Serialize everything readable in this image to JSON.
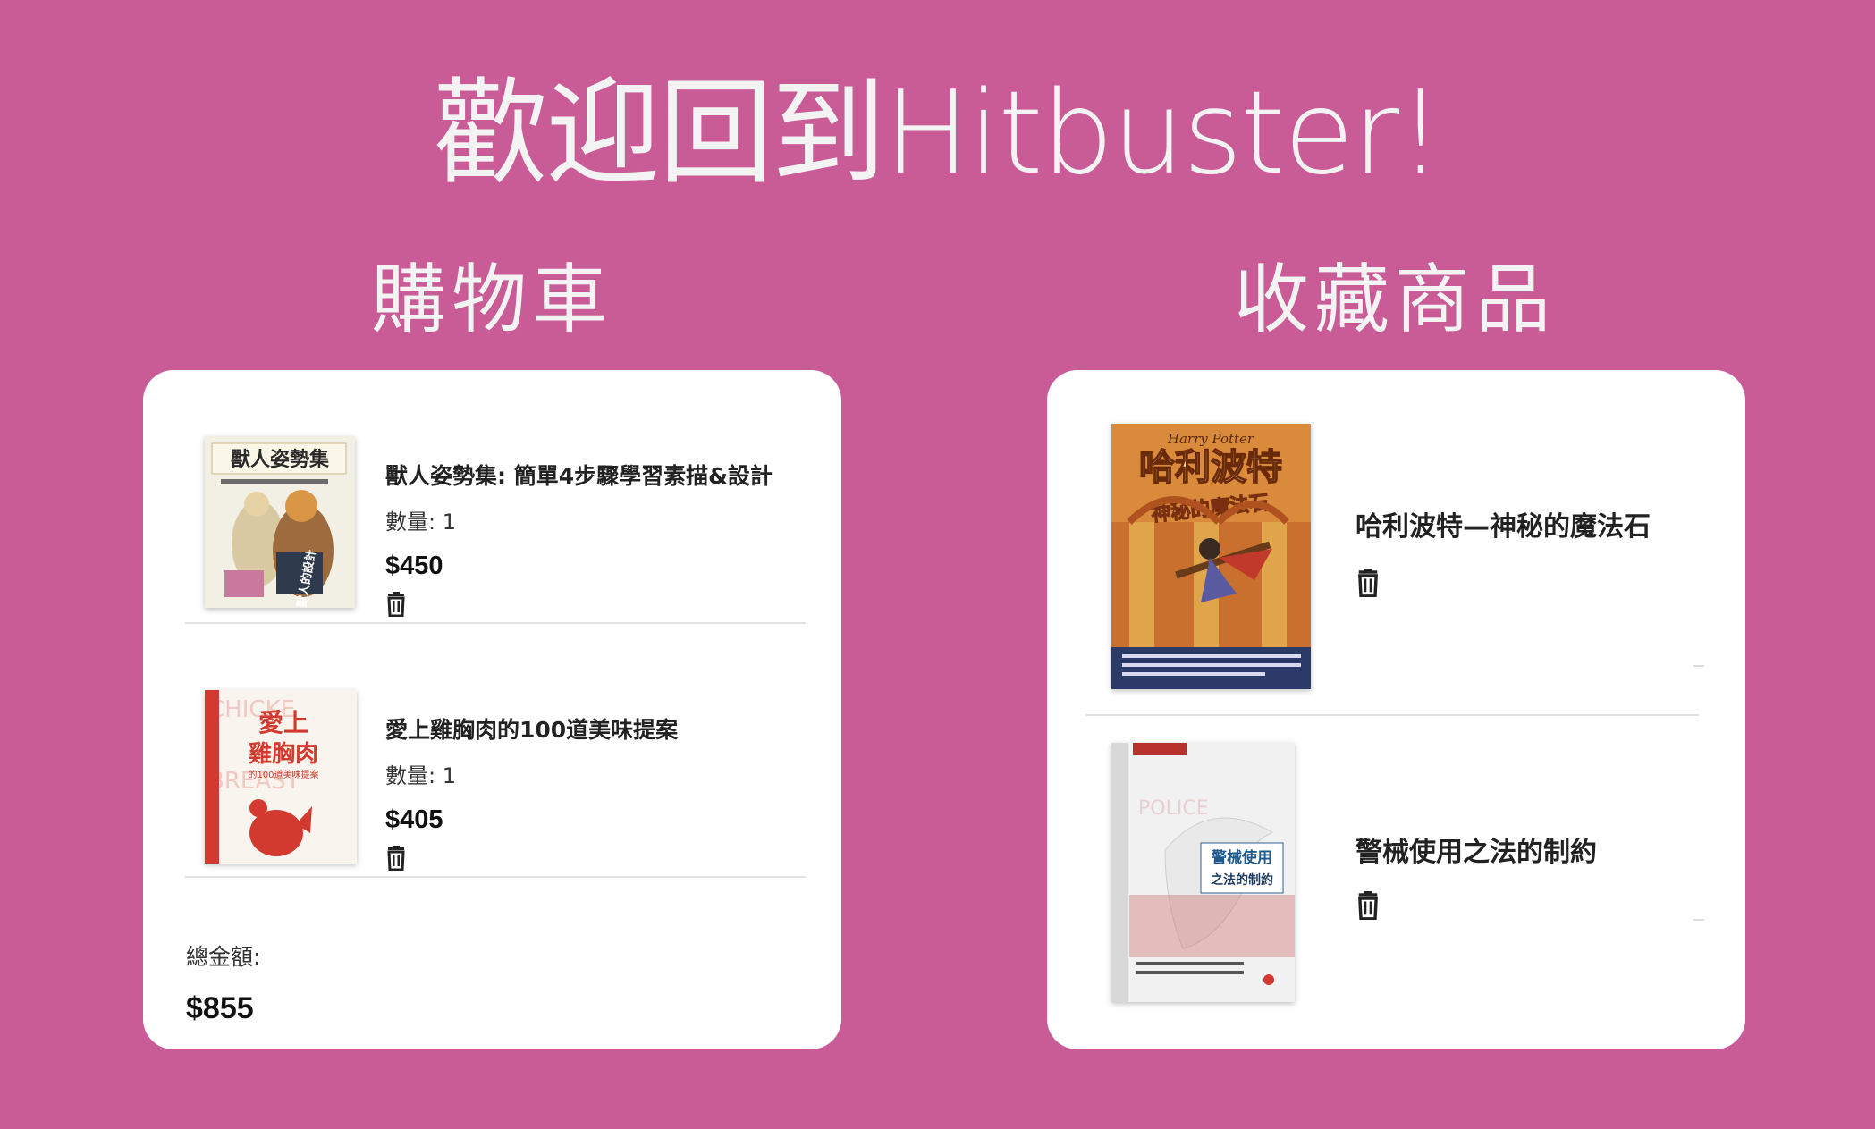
{
  "header": {
    "title": "歡迎回到Hitbuster!"
  },
  "cart": {
    "title": "購物車",
    "quantity_label": "數量:",
    "items": [
      {
        "name": "獸人姿勢集: 簡單4步驟學習素描&設計",
        "quantity": "1",
        "price": "$450",
        "cover_title": "獸人姿勢集",
        "cover_sub": "獸人的設計",
        "trash_icon": "trash-icon"
      },
      {
        "name": "愛上雞胸肉的100道美味提案",
        "quantity": "1",
        "price": "$405",
        "cover_title": "愛上",
        "cover_title2": "雞胸肉",
        "cover_sub": "的100道美味提案",
        "trash_icon": "trash-icon"
      }
    ],
    "total_label": "總金額:",
    "total_value": "$855"
  },
  "favorites": {
    "title": "收藏商品",
    "items": [
      {
        "name": "哈利波特—神秘的魔法石",
        "cover_top": "Harry Potter",
        "cover_title": "哈利波特",
        "cover_sub": "神秘的魔法石",
        "trash_icon": "trash-icon"
      },
      {
        "name": "警械使用之法的制約",
        "cover_badge": "POLICE",
        "cover_title": "警械使用",
        "cover_sub": "之法的制約",
        "trash_icon": "trash-icon"
      }
    ]
  },
  "colors": {
    "background": "#c95b96",
    "card": "#ffffff",
    "heading": "#f3f3f3",
    "text": "#222222"
  }
}
